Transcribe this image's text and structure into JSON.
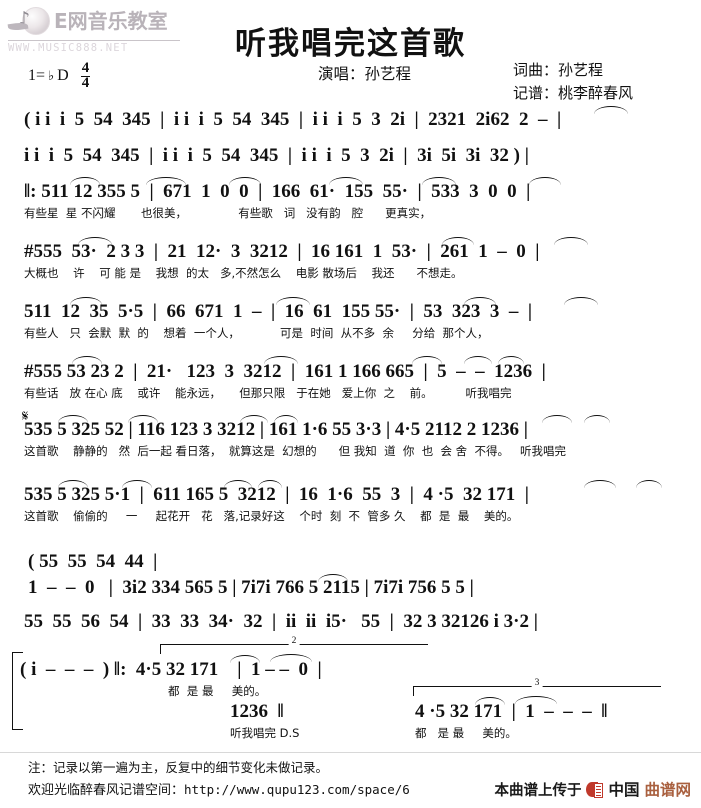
{
  "site": {
    "logo_text": "E网音乐教室",
    "logo_url": "WWW.MUSIC888.NET",
    "icon_note": "♪"
  },
  "header": {
    "title": "听我唱完这首歌",
    "key_label": "1=",
    "key_accidental": "♭",
    "key_name": "D",
    "meter_top": "4",
    "meter_bottom": "4",
    "singer": "演唱：孙艺程",
    "composer": "词曲：孙艺程",
    "transcriber": "记谱：桃李醉春风"
  },
  "score": {
    "systems": [
      {
        "id": "intro-1",
        "notes": "( i i  i  5  54  345  |  i i  i  5  54  345  |  i i  i  5  3  2i  |  2321  2i62  2  –  |",
        "lyrics": ""
      },
      {
        "id": "intro-2",
        "notes": "i i  i  5  54  345  |  i i  i  5  54  345  |  i i  i  5  3  2i  |  3i  5i  3i  32 ) |",
        "lyrics": ""
      },
      {
        "id": "verse-1a",
        "notes": "‖: 511 12 355 5  |  671  1  0  0  |  166  61·  155  55·  |  533  3  0  0  |",
        "lyrics": "有些星  星 不闪耀       也很美，              有些歌   词   没有韵   腔      更真实，"
      },
      {
        "id": "verse-1b",
        "notes": "#555  53·  2 3 3  |  21  12·  3  3212  |  16 161  1  53·  |  261  1  –  0  |",
        "lyrics": "大概也    许    可 能 是    我想  的太   多,不然怎么    电影 散场后    我还      不想走。"
      },
      {
        "id": "verse-2a",
        "notes": "511  12  35  5·5  |  66  671  1  –  |  16  61  155 55·  |  53  323  3  –  |",
        "lyrics": "有些人   只  会默  默  的    想着  一个人，           可是  时间  从不多  余     分给  那个人，"
      },
      {
        "id": "verse-2b",
        "notes": "#555 53 23 2  |  21·   123  3  3212  |  161 1 166 665  |  5  –  –  1236  |",
        "lyrics": "有些话   放 在心 底    或许    能永远，     但那只限   于在她   爱上你  之    前。         听我唱完"
      },
      {
        "id": "chorus-1a",
        "notes": "535 5 325 52 | 116 123 3 3212 | 161 1·6 55 3·3 | 4·5 2112 2 1236 |",
        "lyrics": "这首歌    静静的   然  后一起 看日落，  就算这是  幻想的      但 我知  道  你  也  会 舍  不得。   听我唱完"
      },
      {
        "id": "chorus-1b",
        "notes": "535 5 325 5·1  |  611 165 5  3212  |  16  1·6  55  3  |  4 ·5  32 171  |",
        "lyrics": "这首歌    偷偷的     一     起花开   花   落,记录好这    个时  刻  不  管多 久    都  是  最    美的。"
      },
      {
        "id": "interlude-top",
        "notes": "( 55  55  54  44  |",
        "lyrics": ""
      },
      {
        "id": "interlude-1",
        "notes": "1  –  –  0   |  3i2 334 565 5 | 7i7i 766 5 2115 | 7i7i 756 5 5 |",
        "lyrics": ""
      },
      {
        "id": "interlude-2",
        "notes": "55  55  56  54  |  33  33  34·  32  |  ii  ii  i5·   55  |  32 3 32126 i 3·2 |",
        "lyrics": ""
      },
      {
        "id": "ending-left",
        "notes": "( i  –  –  –  ) ‖:  4·5 32 171    |  1 – –  0  |",
        "lyrics": "都  是 最     美的。"
      },
      {
        "id": "ending-ds",
        "notes": "1236  ‖",
        "lyrics": "听我唱完 D.S"
      },
      {
        "id": "ending-right",
        "notes": "4 ·5 32 171  |  1  –  –  –  ‖",
        "lyrics": "都   是 最     美的。"
      }
    ],
    "volta_2": "2",
    "volta_3": "3",
    "repeat_open": "‖:",
    "segno": "𝄋"
  },
  "footer": {
    "note": "注：记录以第一遍为主，反复中的细节变化未做记录。",
    "space_label": "欢迎光临醉春风记谱空间：",
    "space_url": "http://www.qupu123.com/space/6",
    "upload_prefix": "本曲谱上传于",
    "upload_site_part1": "中国",
    "upload_site_part2": "曲谱网"
  },
  "colors": {
    "background": "#ffffff",
    "text": "#111111",
    "logo_gray": "#b9b3b9",
    "brand_red": "#c0392b",
    "brand_brown": "#a9603f"
  }
}
